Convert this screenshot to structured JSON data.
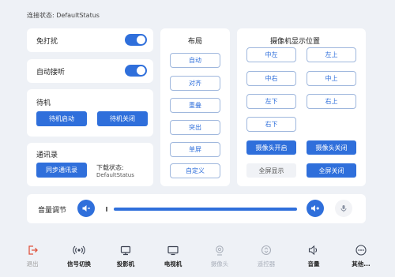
{
  "connection": {
    "status_text": "连接状态: DefaultStatus"
  },
  "settings": {
    "dnd_label": "免打扰",
    "auto_answer_label": "自动接听"
  },
  "standby": {
    "title": "待机",
    "start_label": "待机启动",
    "close_label": "待机关闭"
  },
  "contacts": {
    "title": "通讯录",
    "sync_label": "同步通讯录",
    "download_label": "下载状态:",
    "download_value": "DefaultStatus"
  },
  "layout": {
    "title": "布局",
    "items": [
      "自动",
      "对齐",
      "重叠",
      "突出",
      "单屏",
      "自定义"
    ]
  },
  "camera": {
    "title": "摄像机显示位置",
    "positions": [
      "中左",
      "左上",
      "中右",
      "中上",
      "左下",
      "右上",
      "右下"
    ],
    "on_label": "摄像头开启",
    "off_label": "摄像头关闭",
    "fullscreen_label": "全屏显示",
    "fullscreen_off_label": "全屏关闭"
  },
  "volume": {
    "label": "音量调节",
    "level": 0.0
  },
  "nav": {
    "items": [
      {
        "label": "退出",
        "icon": "exit-icon"
      },
      {
        "label": "信号切换",
        "icon": "signal-icon"
      },
      {
        "label": "投影机",
        "icon": "projector-icon"
      },
      {
        "label": "电视机",
        "icon": "tv-icon"
      },
      {
        "label": "摄像头",
        "icon": "camera-icon"
      },
      {
        "label": "遥控器",
        "icon": "remote-icon"
      },
      {
        "label": "音量",
        "icon": "volume-icon"
      },
      {
        "label": "其他...",
        "icon": "more-icon"
      }
    ]
  },
  "colors": {
    "accent": "#2f6fdb",
    "background": "#eef1f6",
    "exit": "#e0533d"
  }
}
